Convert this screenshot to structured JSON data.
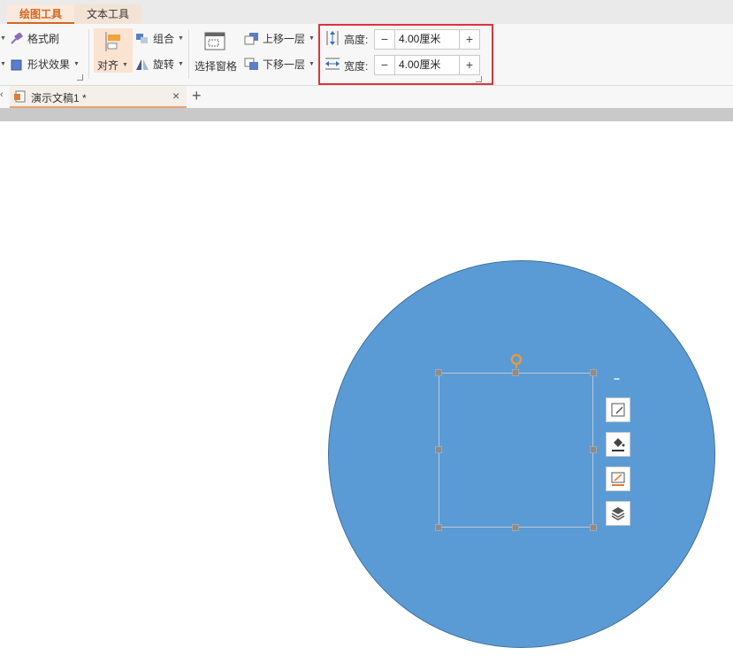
{
  "context_tabs": [
    "绘图工具",
    "文本工具"
  ],
  "ribbon": {
    "format_painter": "格式刷",
    "shape_effects": "形状效果",
    "align": "对齐",
    "group": "组合",
    "rotate": "旋转",
    "selection_pane": "选择窗格",
    "bring_forward": "上移一层",
    "send_backward": "下移一层",
    "height_label": "高度:",
    "height_value": "4.00厘米",
    "width_label": "宽度:",
    "width_value": "4.00厘米",
    "minus": "−",
    "plus": "+"
  },
  "document_tab": {
    "title": "演示文稿1 *",
    "close": "×",
    "add": "+"
  },
  "quick_toolbar": {
    "collapse": "−"
  },
  "colors": {
    "accent": "#d2691e",
    "shape_fill": "#5b9bd5",
    "shape_outline": "#41719c",
    "highlight_box": "#d9363e"
  }
}
